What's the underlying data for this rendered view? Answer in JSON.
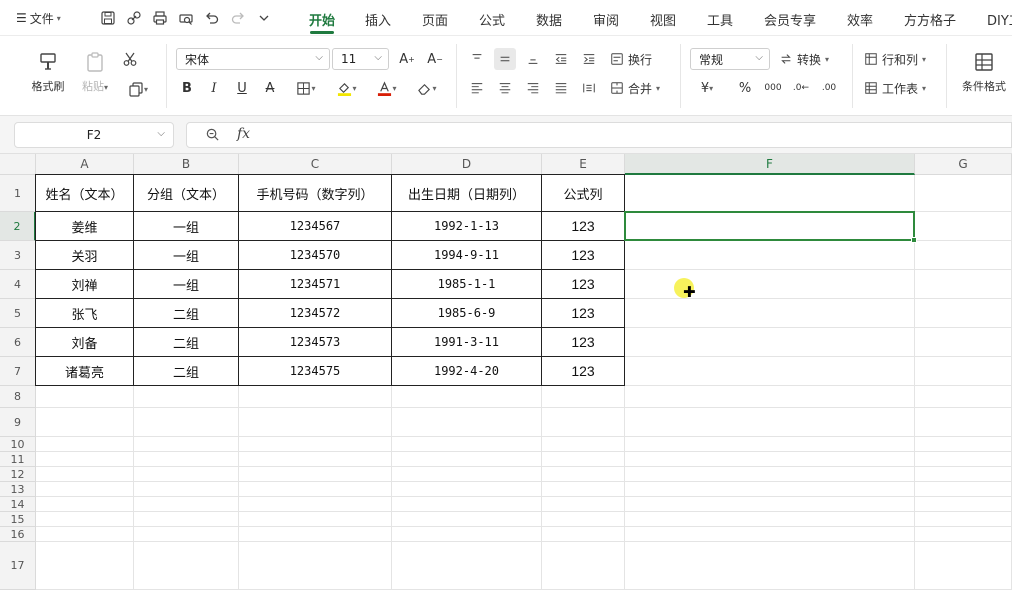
{
  "menu": {
    "file_label": "文件",
    "tabs": [
      "开始",
      "插入",
      "页面",
      "公式",
      "数据",
      "审阅",
      "视图",
      "工具",
      "会员专享",
      "效率",
      "方方格子",
      "DIY工"
    ]
  },
  "ribbon": {
    "format_painter": "格式刷",
    "paste": "粘贴",
    "font_name": "宋体",
    "font_size": "11",
    "wrap_text": "换行",
    "merge": "合并",
    "number_format": "常规",
    "convert": "转换",
    "rows_cols": "行和列",
    "worksheet": "工作表",
    "conditional_format": "条件格式"
  },
  "formula_bar": {
    "name_box": "F2",
    "fx": "fx",
    "content": ""
  },
  "columns": [
    "A",
    "B",
    "C",
    "D",
    "E",
    "F",
    "G"
  ],
  "rows": [
    "1",
    "2",
    "3",
    "4",
    "5",
    "6",
    "7",
    "8",
    "9",
    "10",
    "11",
    "12",
    "13",
    "14",
    "15",
    "16",
    "17"
  ],
  "table": {
    "headers": [
      "姓名（文本）",
      "分组（文本）",
      "手机号码（数字列）",
      "出生日期（日期列）",
      "公式列"
    ],
    "rows": [
      [
        "姜维",
        "一组",
        "1234567",
        "1992-1-13",
        "123"
      ],
      [
        "关羽",
        "一组",
        "1234570",
        "1994-9-11",
        "123"
      ],
      [
        "刘禅",
        "一组",
        "1234571",
        "1985-1-1",
        "123"
      ],
      [
        "张飞",
        "二组",
        "1234572",
        "1985-6-9",
        "123"
      ],
      [
        "刘备",
        "二组",
        "1234573",
        "1991-3-11",
        "123"
      ],
      [
        "诸葛亮",
        "二组",
        "1234575",
        "1992-4-20",
        "123"
      ]
    ]
  },
  "selected_cell": "F2",
  "accent_color": "#1f7a3f",
  "icons": [
    "menu-icon",
    "save-icon",
    "undo-icon",
    "redo-icon",
    "print-icon",
    "zoom-icon"
  ]
}
